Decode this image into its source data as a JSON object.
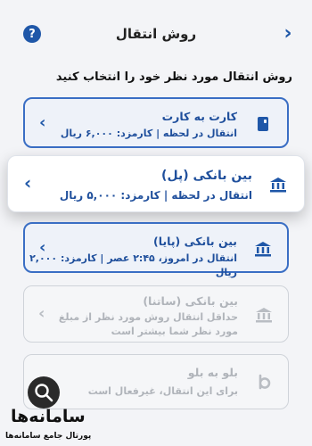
{
  "header": {
    "title": "روش انتقال",
    "help_label": "?"
  },
  "subtitle": "روش انتقال مورد نظر خود را انتخاب کنید",
  "methods": [
    {
      "title": "کارت به کارت",
      "desc": "انتقال در لحظه | کارمزد: ۶,۰۰۰ ریال",
      "state": "active",
      "icon": "card-icon"
    },
    {
      "title": "بین بانکی (پل)",
      "desc": "انتقال در لحظه | کارمزد: ۵,۰۰۰ ریال",
      "state": "selected",
      "icon": "bank-icon"
    },
    {
      "title": "بین بانکی (پایا)",
      "desc": "انتقال در امروز، ۲:۴۵ عصر | کارمزد: ۲,۰۰۰ ریال",
      "state": "active",
      "icon": "bank-icon"
    },
    {
      "title": "بین بانکی (ساتنا)",
      "desc": "حداقل انتقال روش مورد نظر از مبلغ مورد نظر شما بیشتر است",
      "state": "disabled",
      "icon": "bank-icon"
    },
    {
      "title": "بلو به بلو",
      "desc": "برای این انتقال، غیرفعال است",
      "state": "disabled",
      "icon": "blu-icon"
    }
  ],
  "watermark": {
    "name": "سامانه‌ها",
    "tagline": "پورتال جامع سامانه‌ها"
  },
  "colors": {
    "primary": "#1f57a8",
    "active_border": "#3a6ec4",
    "disabled_text": "#b0b4ba",
    "background": "#f3f4f7"
  }
}
